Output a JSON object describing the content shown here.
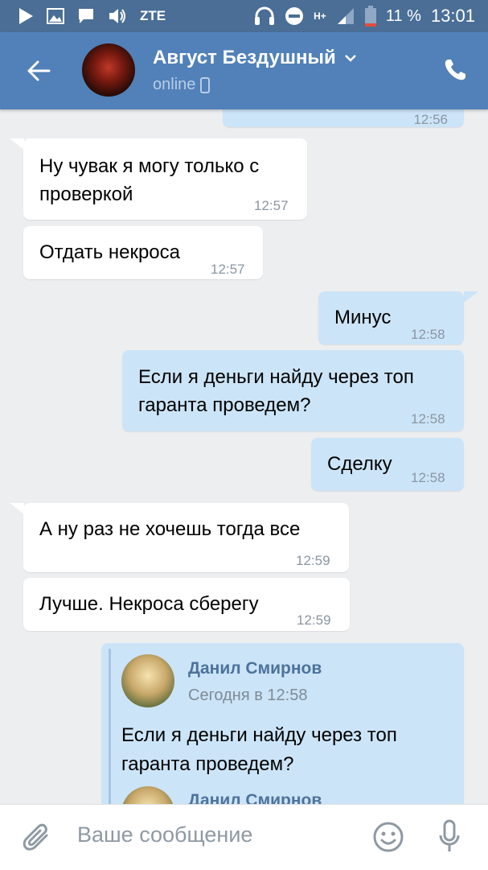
{
  "status_bar": {
    "carrier": "ZTE",
    "battery": "11 %",
    "time": "13:01",
    "network": "H+"
  },
  "header": {
    "contact_name": "Август Бездушный",
    "status": "online"
  },
  "messages": [
    {
      "text": "",
      "time": "12:56"
    },
    {
      "text": "Ну чувак я могу только с",
      "text2": "проверкой",
      "time": "12:57"
    },
    {
      "text": "Отдать некроса",
      "time": "12:57"
    },
    {
      "text": "Минус",
      "time": "12:58"
    },
    {
      "text": "Если я деньги найду через топ",
      "text2": "гаранта проведем?",
      "time": "12:58"
    },
    {
      "text": "Сделку",
      "time": "12:58"
    },
    {
      "text": "А ну раз не хочешь тогда все",
      "time": "12:59"
    },
    {
      "text": "Лучше. Некроса сберегу",
      "time": "12:59"
    }
  ],
  "forwarded": {
    "author": "Данил Смирнов",
    "date": "Сегодня в 12:58",
    "text": "Если я деньги найду через топ",
    "text2": "гаранта проведем?",
    "author2": "Данил Смирнов"
  },
  "input": {
    "placeholder": "Ваше сообщение"
  }
}
